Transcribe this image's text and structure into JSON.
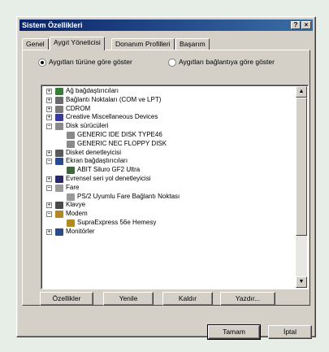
{
  "window": {
    "title": "Sistem Özellikleri",
    "help_button": "?",
    "close_button": "×"
  },
  "tabs": [
    {
      "label": "Genel",
      "active": false
    },
    {
      "label": "Aygıt Yöneticisi",
      "active": true
    },
    {
      "label": "Donanım Profilleri",
      "active": false
    },
    {
      "label": "Başarım",
      "active": false
    }
  ],
  "view_options": {
    "by_type": {
      "label": "Aygıtları türüne göre göster",
      "selected": true
    },
    "by_connection": {
      "label": "Aygıtları bağlantıya göre göster",
      "selected": false
    }
  },
  "tree": [
    {
      "label": "Ağ bağdaştırıcıları",
      "expander": "+",
      "icon": "network-icon",
      "level": 0
    },
    {
      "label": "Bağlantı Noktaları (COM ve LPT)",
      "expander": "+",
      "icon": "port-icon",
      "level": 0
    },
    {
      "label": "CDROM",
      "expander": "+",
      "icon": "cdrom-icon",
      "level": 0
    },
    {
      "label": "Creative Miscellaneous Devices",
      "expander": "+",
      "icon": "device-icon",
      "level": 0
    },
    {
      "label": "Disk sürücüleri",
      "expander": "−",
      "icon": "disk-icon",
      "level": 0
    },
    {
      "label": "GENERIC IDE DISK TYPE46",
      "expander": "",
      "icon": "disk-icon",
      "level": 1
    },
    {
      "label": "GENERIC NEC FLOPPY DISK",
      "expander": "",
      "icon": "disk-icon",
      "level": 1
    },
    {
      "label": "Disket denetleyicisi",
      "expander": "+",
      "icon": "floppy-controller-icon",
      "level": 0
    },
    {
      "label": "Ekran bağdaştırıcıları",
      "expander": "−",
      "icon": "monitor-icon",
      "level": 0
    },
    {
      "label": "ABIT Siluro GF2 Ultra",
      "expander": "",
      "icon": "display-card-icon",
      "level": 1
    },
    {
      "label": "Evrensel seri yol denetleyicisi",
      "expander": "+",
      "icon": "usb-icon",
      "level": 0
    },
    {
      "label": "Fare",
      "expander": "−",
      "icon": "mouse-icon",
      "level": 0
    },
    {
      "label": "PS/2 Uyumlu Fare Bağlantı Noktası",
      "expander": "",
      "icon": "mouse-icon",
      "level": 1
    },
    {
      "label": "Klavye",
      "expander": "+",
      "icon": "keyboard-icon",
      "level": 0
    },
    {
      "label": "Modem",
      "expander": "−",
      "icon": "modem-icon",
      "level": 0
    },
    {
      "label": "SupraExpress 56e Hemesy",
      "expander": "",
      "icon": "modem-icon",
      "level": 1
    },
    {
      "label": "Monitörler",
      "expander": "+",
      "icon": "monitor-icon",
      "level": 0
    }
  ],
  "action_buttons": {
    "properties": "Özellikler",
    "refresh": "Yenile",
    "remove": "Kaldır",
    "print": "Yazdır..."
  },
  "dialog_buttons": {
    "ok": "Tamam",
    "cancel": "İptal"
  },
  "colors": {
    "titlebar_start": "#0a246a",
    "titlebar_end": "#3a6ea5",
    "face": "#d4d0c8",
    "background": "#e6eee7"
  }
}
